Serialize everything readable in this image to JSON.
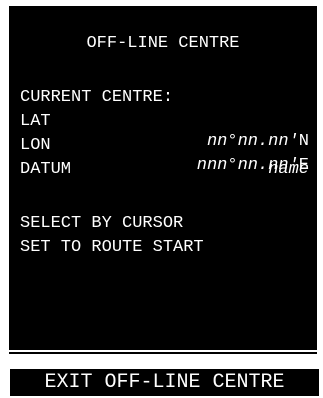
{
  "screen": {
    "title": "OFF-LINE CENTRE",
    "current_centre": {
      "heading": "CURRENT CENTRE:",
      "lat": {
        "label": "LAT",
        "value": "nn°nn.nn'",
        "suffix": "N"
      },
      "lon": {
        "label": "LON",
        "value": "nnn°nn.nn'",
        "suffix": "E"
      },
      "datum": {
        "label": "DATUM",
        "value": "name"
      }
    },
    "menu": [
      {
        "label": "SELECT BY CURSOR"
      },
      {
        "label": "SET TO ROUTE START"
      }
    ],
    "footer": {
      "label": "EXIT OFF-LINE CENTRE"
    }
  },
  "colors": {
    "background": "#000000",
    "text": "#ffffff"
  }
}
